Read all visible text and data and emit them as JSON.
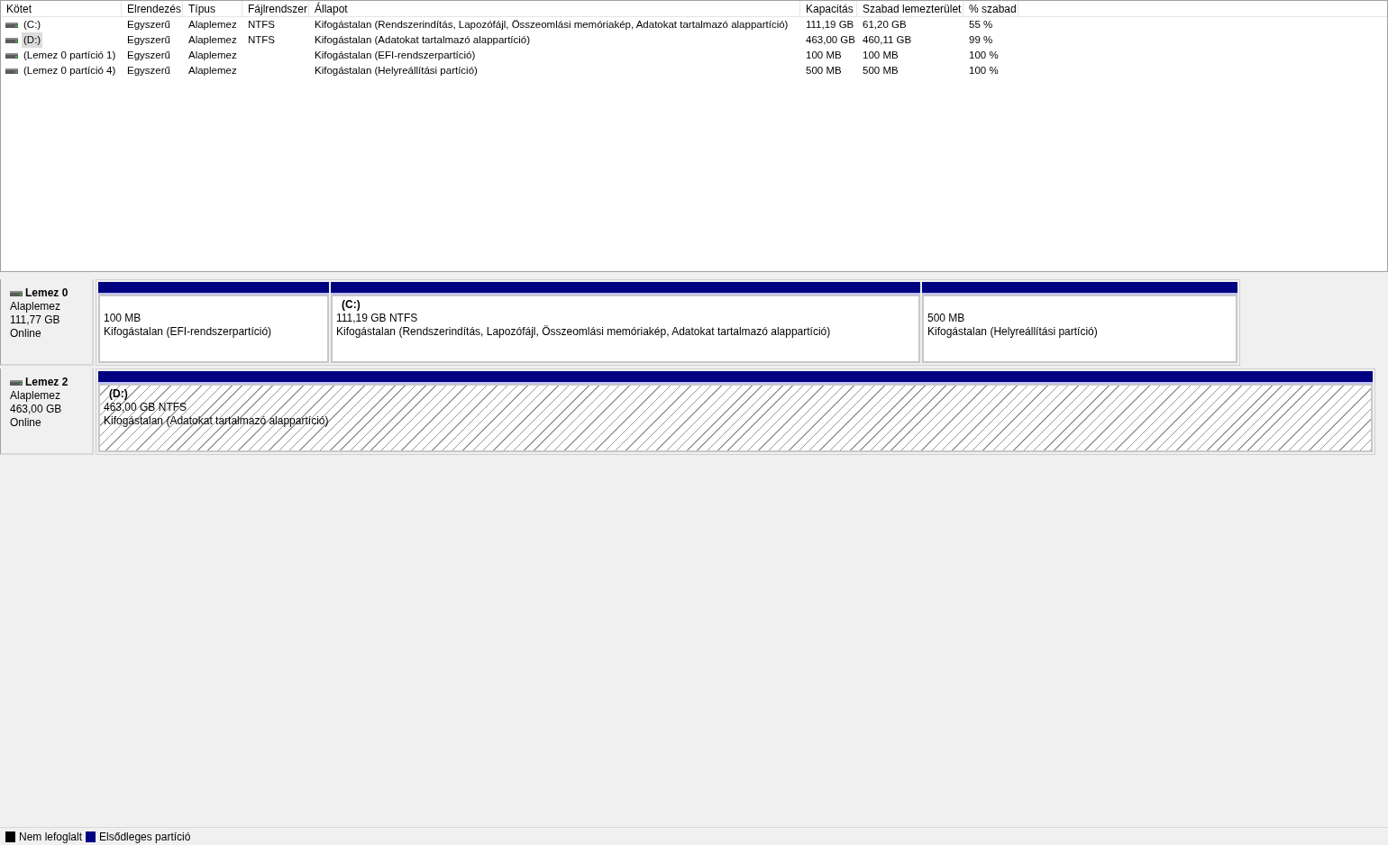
{
  "volume_table": {
    "columns": [
      "Kötet",
      "Elrendezés",
      "Típus",
      "Fájlrendszer",
      "Állapot",
      "Kapacitás",
      "Szabad lemezterület",
      "% szabad"
    ],
    "rows": [
      {
        "cells": [
          "(C:)",
          "Egyszerű",
          "Alaplemez",
          "NTFS",
          "Kifogástalan (Rendszerindítás, Lapozófájl, Összeomlási memóriakép, Adatokat tartalmazó alappartíció)",
          "111,19 GB",
          "61,20 GB",
          "55 %"
        ],
        "selected": false
      },
      {
        "cells": [
          "(D:)",
          "Egyszerű",
          "Alaplemez",
          "NTFS",
          "Kifogástalan (Adatokat tartalmazó alappartíció)",
          "463,00 GB",
          "460,11 GB",
          "99 %"
        ],
        "selected": true
      },
      {
        "cells": [
          "(Lemez 0 partíció 1)",
          "Egyszerű",
          "Alaplemez",
          "",
          "Kifogástalan (EFI-rendszerpartíció)",
          "100 MB",
          "100 MB",
          "100 %"
        ],
        "selected": false
      },
      {
        "cells": [
          "(Lemez 0 partíció 4)",
          "Egyszerű",
          "Alaplemez",
          "",
          "Kifogástalan (Helyreállítási partíció)",
          "500 MB",
          "500 MB",
          "100 %"
        ],
        "selected": false
      }
    ]
  },
  "disks": [
    {
      "name": "Lemez 0",
      "type": "Alaplemez",
      "size": "111,77 GB",
      "status": "Online",
      "partitions": [
        {
          "size": "100 MB",
          "status": "Kifogástalan (EFI-rendszerpartíció)",
          "selected": false
        },
        {
          "label": "(C:)",
          "size": "111,19 GB NTFS",
          "status": "Kifogástalan (Rendszerindítás, Lapozófájl, Összeomlási memóriakép, Adatokat tartalmazó alappartíció)",
          "selected": false
        },
        {
          "size": "500 MB",
          "status": "Kifogástalan (Helyreállítási partíció)",
          "selected": false
        }
      ]
    },
    {
      "name": "Lemez 2",
      "type": "Alaplemez",
      "size": "463,00 GB",
      "status": "Online",
      "partitions": [
        {
          "label": "(D:)",
          "size": "463,00 GB NTFS",
          "status": "Kifogástalan (Adatokat tartalmazó alappartíció)",
          "selected": true
        }
      ]
    }
  ],
  "legend": [
    {
      "label": "Nem lefoglalt",
      "color": "#000000"
    },
    {
      "label": "Elsődleges partíció",
      "color": "#000080"
    }
  ]
}
